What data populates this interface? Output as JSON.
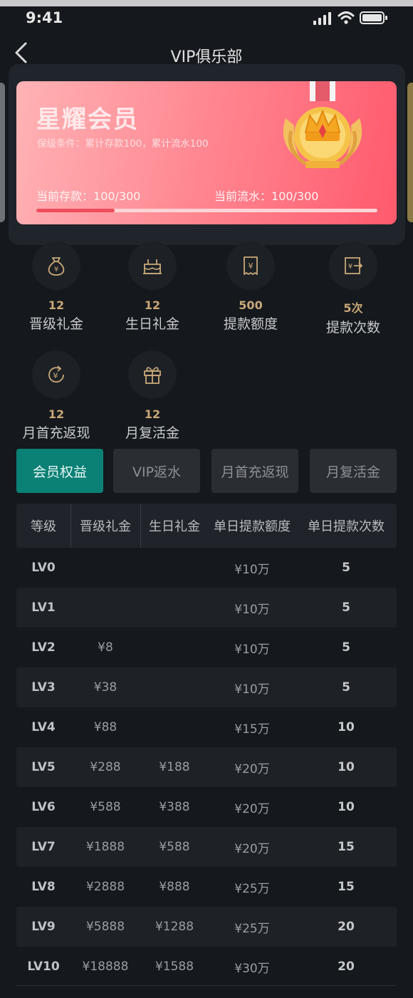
{
  "status": {
    "time": "9:41"
  },
  "nav": {
    "title": "VIP俱乐部"
  },
  "card": {
    "title": "星耀会员",
    "condition": "保级条件：累计存款100，累计流水100",
    "deposit_label": "当前存款：",
    "deposit_value": "100/300",
    "flow_label": "当前流水：",
    "flow_value": "100/300",
    "progress_fraction": 0.23,
    "gradient_colors": [
      "#ffb3b5",
      "#ff5a6d"
    ]
  },
  "benefits": [
    {
      "value": "12",
      "label": "晋级礼金",
      "icon": "money-bag-icon"
    },
    {
      "value": "12",
      "label": "生日礼金",
      "icon": "birthday-cake-icon"
    },
    {
      "value": "500",
      "label": "提款额度",
      "icon": "receipt-icon"
    },
    {
      "value": "5次",
      "label": "提款次数",
      "icon": "withdraw-icon"
    },
    {
      "value": "12",
      "label": "月首充返现",
      "icon": "cashback-icon"
    },
    {
      "value": "12",
      "label": "月复活金",
      "icon": "gift-icon"
    }
  ],
  "tabs": [
    {
      "label": "会员权益",
      "active": true
    },
    {
      "label": "VIP返水",
      "active": false
    },
    {
      "label": "月首充返现",
      "active": false
    },
    {
      "label": "月复活金",
      "active": false
    }
  ],
  "table": {
    "headers": [
      "等级",
      "晋级礼金",
      "生日礼金",
      "单日提款额度",
      "单日提款次数"
    ],
    "rows": [
      [
        "LV0",
        "",
        "",
        "¥10万",
        "5"
      ],
      [
        "LV1",
        "",
        "",
        "¥10万",
        "5"
      ],
      [
        "LV2",
        "¥8",
        "",
        "¥10万",
        "5"
      ],
      [
        "LV3",
        "¥38",
        "",
        "¥10万",
        "5"
      ],
      [
        "LV4",
        "¥88",
        "",
        "¥15万",
        "10"
      ],
      [
        "LV5",
        "¥288",
        "¥188",
        "¥20万",
        "10"
      ],
      [
        "LV6",
        "¥588",
        "¥388",
        "¥20万",
        "10"
      ],
      [
        "LV7",
        "¥1888",
        "¥588",
        "¥20万",
        "15"
      ],
      [
        "LV8",
        "¥2888",
        "¥888",
        "¥25万",
        "15"
      ],
      [
        "LV9",
        "¥5888",
        "¥1288",
        "¥25万",
        "20"
      ],
      [
        "LV10",
        "¥18888",
        "¥1588",
        "¥30万",
        "20"
      ]
    ]
  },
  "colors": {
    "accent": "#0b8176",
    "gold": "#c9a878",
    "background": "#15181c"
  }
}
